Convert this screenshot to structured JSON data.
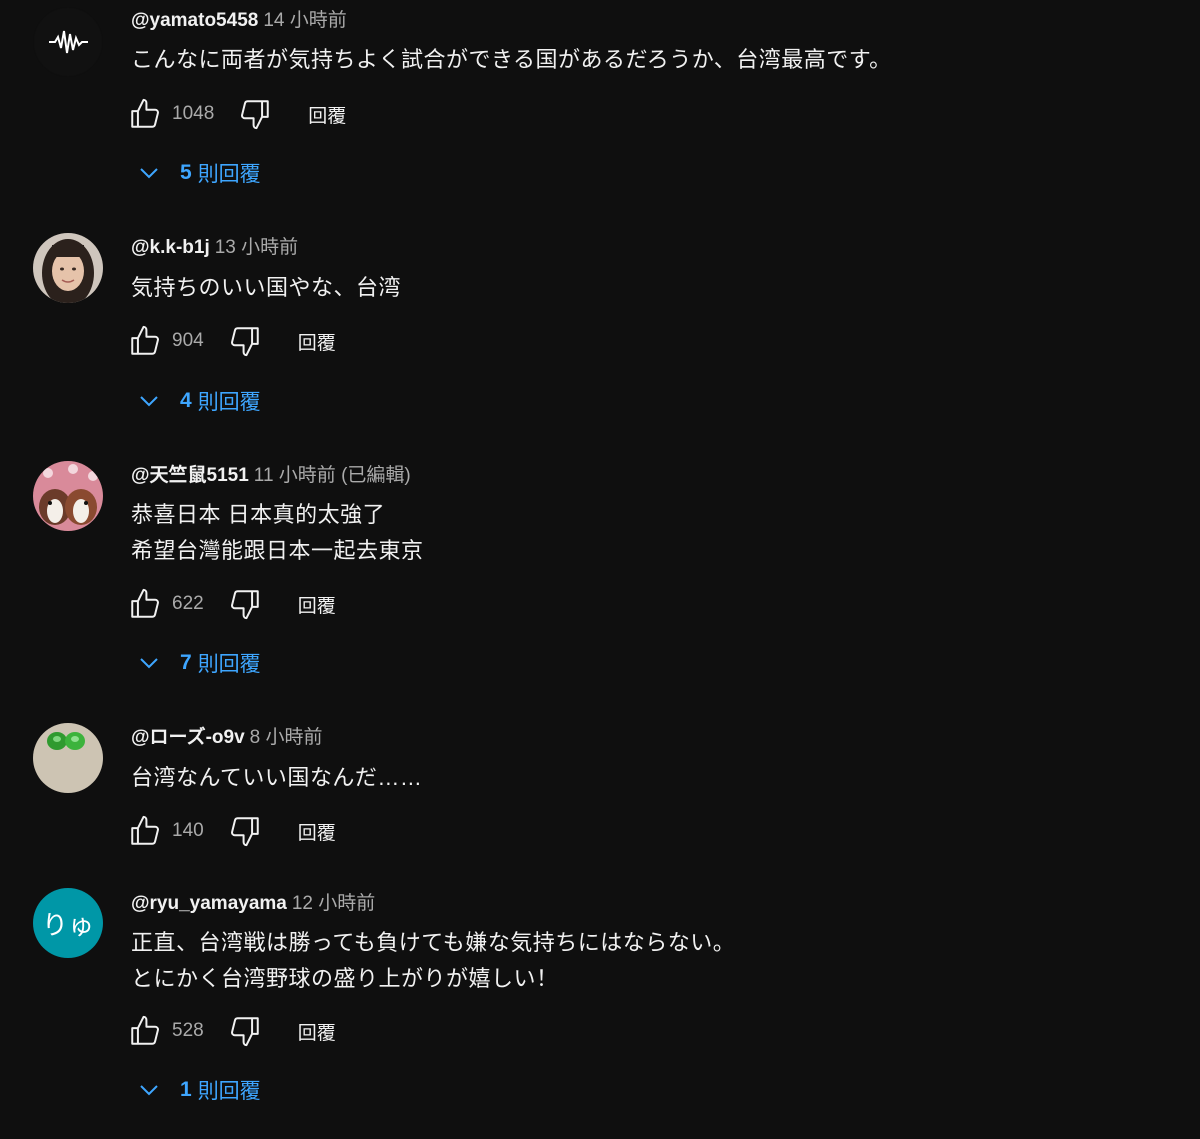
{
  "comments": [
    {
      "author": "@yamato5458",
      "time": "14 小時前",
      "lines": "こんなに両者が気持ちよく試合ができる国があるだろうか、台湾最高です。",
      "likes": "1048",
      "reply_label": "回覆",
      "replies_count": "5",
      "replies_label": "則回覆",
      "avatar": "waveform-avatar"
    },
    {
      "author": "@k.k-b1j",
      "time": "13 小時前",
      "lines": "気持ちのいい国やな、台湾",
      "likes": "904",
      "reply_label": "回覆",
      "replies_count": "4",
      "replies_label": "則回覆",
      "avatar": "person-photo-avatar"
    },
    {
      "author": "@天竺鼠5151",
      "time": "11 小時前 (已編輯)",
      "lines": "恭喜日本 日本真的太強了\n希望台灣能跟日本一起去東京",
      "likes": "622",
      "reply_label": "回覆",
      "replies_count": "7",
      "replies_label": "則回覆",
      "avatar": "guinea-pig-photo-avatar"
    },
    {
      "author": "@ローズ-o9v",
      "time": "8 小時前",
      "lines": "台湾なんていい国なんだ……",
      "likes": "140",
      "reply_label": "回覆",
      "avatar": "green-objects-photo-avatar"
    },
    {
      "author": "@ryu_yamayama",
      "time": "12 小時前",
      "lines": "正直、台湾戦は勝っても負けても嫌な気持ちにはならない。\nとにかく台湾野球の盛り上がりが嬉しい！",
      "likes": "528",
      "reply_label": "回覆",
      "replies_count": "1",
      "replies_label": "則回覆",
      "avatar_text": "りゅ",
      "avatar_color": "#0097a7"
    }
  ],
  "colors": {
    "background": "#0f0f0f",
    "link_blue": "#3ea6ff",
    "meta_gray": "#aaaaaa"
  }
}
